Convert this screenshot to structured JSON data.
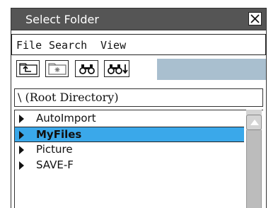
{
  "window": {
    "title": "Select Folder",
    "close_label": "×"
  },
  "menu": {
    "items": [
      "File",
      "Search",
      "View"
    ]
  },
  "toolbar": {
    "buttons": [
      "parent-folder-icon",
      "new-folder-icon",
      "search-icon",
      "search-next-icon"
    ],
    "colors": {
      "bar": "#a9bfcf"
    }
  },
  "path": {
    "text": "\\  (Root Directory)"
  },
  "folders": {
    "items": [
      {
        "label": "AutoImport",
        "selected": false
      },
      {
        "label": "MyFiles",
        "selected": true
      },
      {
        "label": "Picture",
        "selected": false
      },
      {
        "label": "SAVE-F",
        "selected": false
      }
    ]
  },
  "colors": {
    "titlebar": "#555555",
    "selection": "#3aa8ea",
    "scrollbar": "#d4d4d4"
  }
}
